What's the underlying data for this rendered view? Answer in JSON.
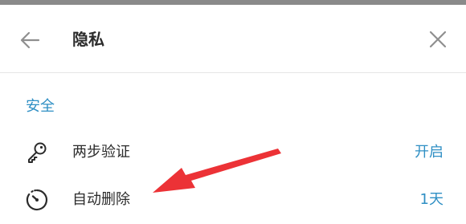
{
  "header": {
    "title": "隐私",
    "back_icon": "back-arrow-icon",
    "close_icon": "close-icon"
  },
  "section": {
    "title": "安全"
  },
  "rows": [
    {
      "label": "两步验证",
      "value": "开启",
      "icon": "key-icon"
    },
    {
      "label": "自动删除",
      "value": "1天",
      "icon": "timer-icon"
    }
  ],
  "colors": {
    "accent": "#2f8fc4",
    "text": "#2b2b2b",
    "annotation_arrow": "#ec3236"
  }
}
